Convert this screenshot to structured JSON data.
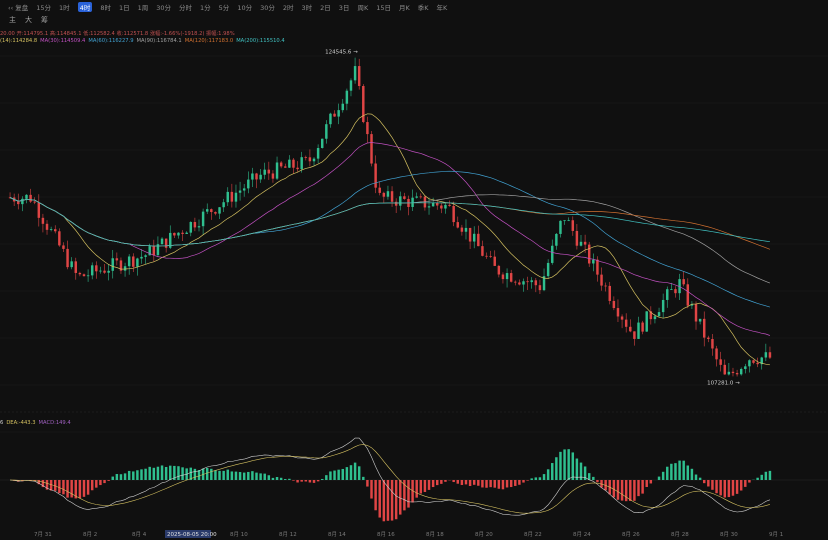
{
  "toolbar": {
    "symbol": "‹‹ 复盘",
    "items": [
      "15分",
      "1时",
      "4时",
      "8时",
      "1日",
      "1周",
      "30分",
      "分时",
      "1分",
      "5分",
      "10分",
      "30分",
      "2时",
      "3时",
      "2日",
      "3日",
      "周K",
      "15日",
      "月K",
      "季K",
      "年K"
    ],
    "active_index": 2,
    "tools": [
      "主",
      "大",
      "筹"
    ]
  },
  "ohlc_text": "20.00 开:114795.1 高:114845.1 低:112582.4 收:112571.8 涨幅:-1.66%(-1918.2) 振幅:1.98%",
  "ma_legend": [
    {
      "text": "(14):114284.8",
      "color": "#d4c060"
    },
    {
      "text": "MA(30):114509.4",
      "color": "#c050c0"
    },
    {
      "text": "MA(60):116227.9",
      "color": "#40a0d0"
    },
    {
      "text": "MA(90):116784.1",
      "color": "#a0a0a0"
    },
    {
      "text": "MA(120):117183.0",
      "color": "#d07030"
    },
    {
      "text": "MA(200):115510.4",
      "color": "#40c0c0"
    }
  ],
  "macd_legend": [
    {
      "text": "6",
      "color": "#d0d0d0"
    },
    {
      "text": "DEA:-443.3",
      "color": "#d4c060"
    },
    {
      "text": "MACD:149.4",
      "color": "#a060c0"
    }
  ],
  "colors": {
    "up": "#2fbf8f",
    "down": "#e04545",
    "background": "#101010"
  },
  "chart_data": {
    "type": "candlestick",
    "x_tick_labels": [
      "7月 31",
      "8月 2",
      "8月 4",
      "2025-08-05 20:00",
      "8月 10",
      "8月 12",
      "8月 14",
      "8月 16",
      "8月 18",
      "8月 20",
      "8月 22",
      "8月 24",
      "8月 26",
      "8月 28",
      "8月 30",
      "9月 1"
    ],
    "annotations": [
      {
        "label": "124545.6",
        "value": 124545.6,
        "kind": "high"
      },
      {
        "label": "107281.0",
        "value": 107281.0,
        "kind": "low"
      }
    ],
    "price_anchors": [
      {
        "date": "07-31",
        "price": 117500
      },
      {
        "date": "08-02",
        "price": 113000
      },
      {
        "date": "08-05",
        "price": 114300
      },
      {
        "date": "08-10",
        "price": 118800
      },
      {
        "date": "08-12",
        "price": 119500
      },
      {
        "date": "08-14",
        "price": 124545.6
      },
      {
        "date": "08-15",
        "price": 117500
      },
      {
        "date": "08-18",
        "price": 117000
      },
      {
        "date": "08-20",
        "price": 113500
      },
      {
        "date": "08-22",
        "price": 112500
      },
      {
        "date": "08-23",
        "price": 116500
      },
      {
        "date": "08-26",
        "price": 109800
      },
      {
        "date": "08-28",
        "price": 112700
      },
      {
        "date": "08-30",
        "price": 107281.0
      },
      {
        "date": "08-31",
        "price": 108500
      }
    ],
    "ma_series": [
      {
        "name": "MA(30)",
        "color": "#c050c0"
      },
      {
        "name": "MA(60)",
        "color": "#40a0d0"
      },
      {
        "name": "MA(90)",
        "color": "#a0a0a0"
      },
      {
        "name": "MA(120)",
        "color": "#d07030"
      },
      {
        "name": "MA(200)",
        "color": "#40c0c0"
      }
    ],
    "y_range": [
      105000,
      126000
    ]
  }
}
